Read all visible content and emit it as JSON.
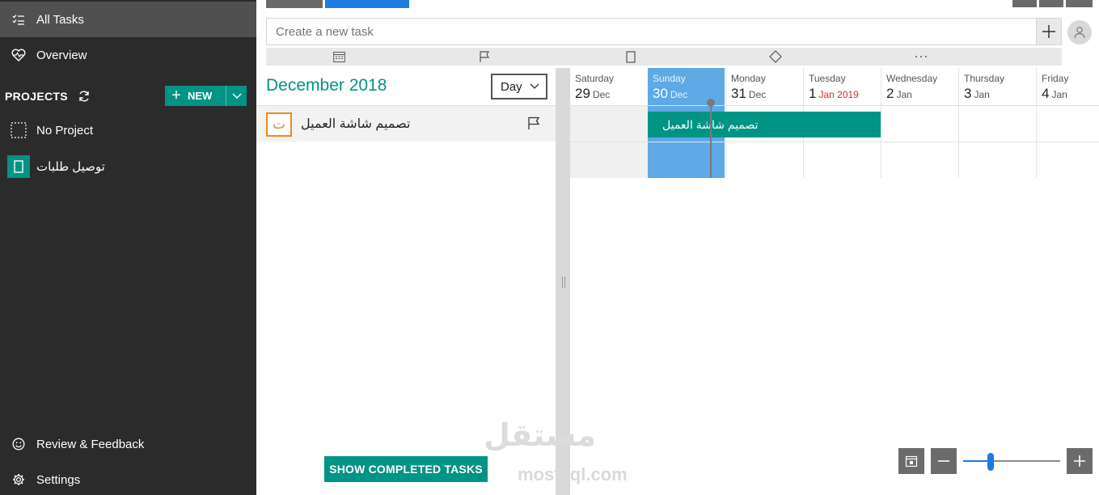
{
  "sidebar": {
    "items": [
      {
        "label": "All Tasks",
        "icon": "list-check-icon",
        "active": true
      },
      {
        "label": "Overview",
        "icon": "heart-pulse-icon",
        "active": false
      }
    ],
    "projects_label": "PROJECTS",
    "new_label": "NEW",
    "projects": [
      {
        "label": "No Project",
        "icon": "dashed-square-icon"
      },
      {
        "label": "توصيل طلبات",
        "icon": "notebook-icon",
        "color": "#009485"
      }
    ],
    "bottom": [
      {
        "label": "Review & Feedback",
        "icon": "smiley-icon"
      },
      {
        "label": "Settings",
        "icon": "gear-icon"
      }
    ]
  },
  "toolbar": {
    "create_placeholder": "Create a new task"
  },
  "list": {
    "month_title": "December 2018",
    "view_select": "Day",
    "tasks": [
      {
        "badge": "ت",
        "title": "تصميم شاشة العميل"
      }
    ],
    "show_completed_label": "SHOW COMPLETED TASKS"
  },
  "timeline": {
    "days": [
      {
        "name": "Saturday",
        "day": "29",
        "month": "Dec",
        "highlight": false,
        "month_alert": false
      },
      {
        "name": "Sunday",
        "day": "30",
        "month": "Dec",
        "highlight": true,
        "month_alert": false
      },
      {
        "name": "Monday",
        "day": "31",
        "month": "Dec",
        "highlight": false,
        "month_alert": false
      },
      {
        "name": "Tuesday",
        "day": "1",
        "month": "Jan 2019",
        "highlight": false,
        "month_alert": true
      },
      {
        "name": "Wednesday",
        "day": "2",
        "month": "Jan",
        "highlight": false,
        "month_alert": false
      },
      {
        "name": "Thursday",
        "day": "3",
        "month": "Jan",
        "highlight": false,
        "month_alert": false
      },
      {
        "name": "Friday",
        "day": "4",
        "month": "Jan",
        "highlight": false,
        "month_alert": false
      }
    ],
    "task_bar_label": "تصميم شاشة العميل"
  },
  "zoom": {
    "level": 0.28
  },
  "watermark": {
    "main": "مستقل",
    "sub": "mostaql.com"
  },
  "colors": {
    "accent": "#009485",
    "today": "#5ea9e6",
    "tab_active": "#1e7be0",
    "sidebar_bg": "#2b2b2b",
    "badge": "#f08a1c",
    "alert": "#d32f2f"
  }
}
